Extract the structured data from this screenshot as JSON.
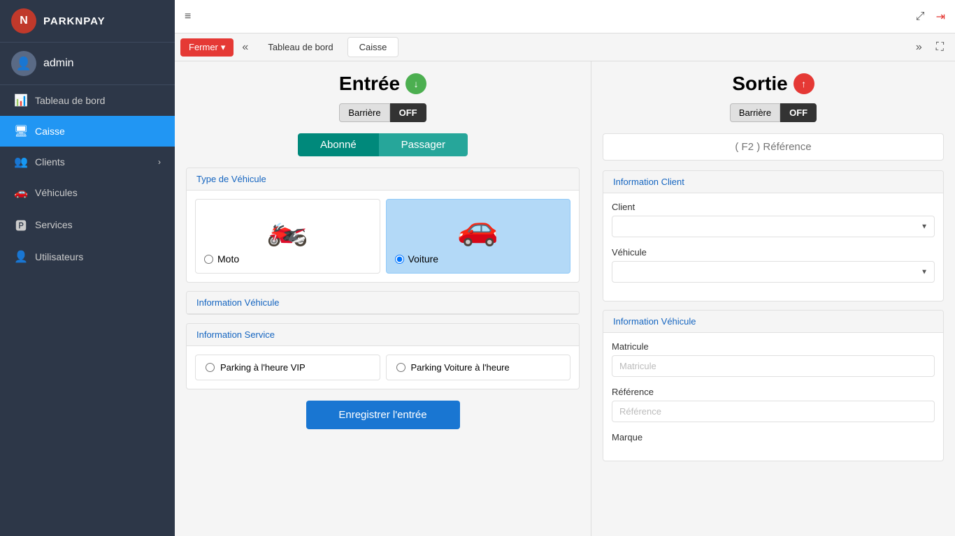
{
  "app": {
    "name": "PARKNPAY",
    "logo_text": "N"
  },
  "user": {
    "name": "admin",
    "avatar": "👤"
  },
  "sidebar": {
    "items": [
      {
        "id": "tableau",
        "label": "Tableau de bord",
        "icon": "📊",
        "active": false
      },
      {
        "id": "caisse",
        "label": "Caisse",
        "icon": "🖥",
        "active": true
      },
      {
        "id": "clients",
        "label": "Clients",
        "icon": "👥",
        "active": false,
        "has_chevron": true
      },
      {
        "id": "vehicules",
        "label": "Véhicules",
        "icon": "🚗",
        "active": false
      },
      {
        "id": "services",
        "label": "Services",
        "icon": "🅿",
        "active": false
      },
      {
        "id": "utilisateurs",
        "label": "Utilisateurs",
        "icon": "👤",
        "active": false
      }
    ]
  },
  "topbar": {
    "menu_icon": "≡",
    "collapse_icon": "⤢",
    "logout_icon": "→"
  },
  "tabbar": {
    "fermer_label": "Fermer",
    "fermer_chevron": "▾",
    "prev_icon": "«",
    "tabs": [
      {
        "label": "Tableau de bord",
        "active": false
      },
      {
        "label": "Caisse",
        "active": true
      }
    ],
    "next_icon": "»",
    "expand_icon": "⛶"
  },
  "entree": {
    "title": "Entrée",
    "arrow": "↓",
    "barriere_label": "Barrière",
    "barriere_state": "OFF",
    "abonne_label": "Abonné",
    "passager_label": "Passager",
    "vehicle_section": "Type de Véhicule",
    "vehicles": [
      {
        "id": "moto",
        "label": "Moto",
        "emoji": "🏍️",
        "selected": false
      },
      {
        "id": "voiture",
        "label": "Voiture",
        "emoji": "🚗",
        "selected": true
      }
    ],
    "info_vehicule_section": "Information Véhicule",
    "info_service_section": "Information Service",
    "services": [
      {
        "id": "vip",
        "label": "Parking à l'heure VIP"
      },
      {
        "id": "voiture_heure",
        "label": "Parking Voiture à l'heure"
      }
    ],
    "register_btn": "Enregistrer l'entrée"
  },
  "sortie": {
    "title": "Sortie",
    "arrow": "↑",
    "barriere_label": "Barrière",
    "barriere_state": "OFF",
    "f2_placeholder": "( F2 ) Référence",
    "info_client_section": "Information Client",
    "client_label": "Client",
    "vehicule_label": "Véhicule",
    "info_vehicule_section": "Information Véhicule",
    "matricule_label": "Matricule",
    "matricule_placeholder": "Matricule",
    "reference_label": "Référence",
    "reference_placeholder": "Référence",
    "marque_label": "Marque"
  },
  "colors": {
    "primary_blue": "#1976d2",
    "active_nav": "#2196f3",
    "teal_active": "#00897b",
    "teal_inactive": "#26a69a",
    "danger_red": "#e53935",
    "green_arrow": "#4caf50",
    "sidebar_bg": "#2d3748"
  }
}
